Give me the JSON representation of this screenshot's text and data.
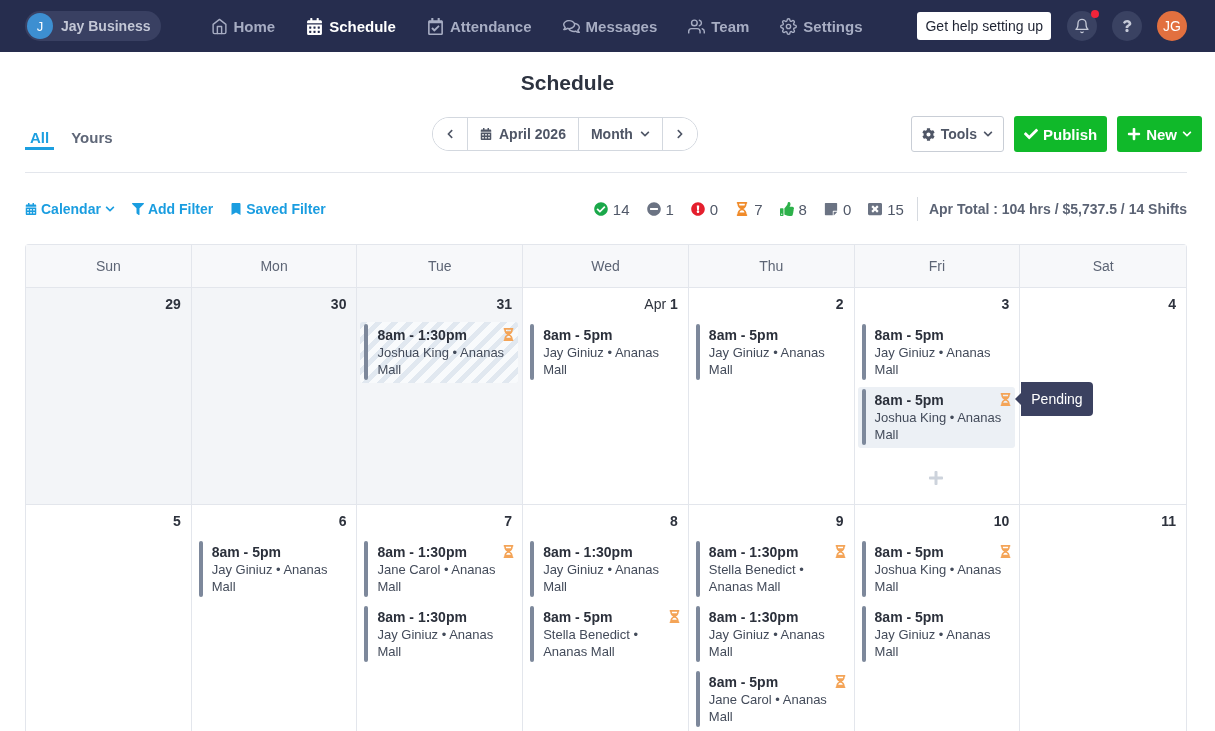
{
  "top_nav": {
    "workspace": {
      "initial": "J",
      "name": "Jay Business"
    },
    "items": [
      {
        "kind": "home",
        "label": "Home",
        "selected": false
      },
      {
        "kind": "schedule",
        "label": "Schedule",
        "selected": true
      },
      {
        "kind": "attendance",
        "label": "Attendance",
        "selected": false
      },
      {
        "kind": "messages",
        "label": "Messages",
        "selected": false
      },
      {
        "kind": "team",
        "label": "Team",
        "selected": false
      },
      {
        "kind": "settings",
        "label": "Settings",
        "selected": false
      }
    ],
    "help_button": "Get help setting up",
    "unread_notifications": true,
    "user_initials": "JG"
  },
  "page_title": "Schedule",
  "view_tabs": [
    {
      "label": "All",
      "selected": true
    },
    {
      "label": "Yours",
      "selected": false
    }
  ],
  "date_nav": {
    "period": "April 2026",
    "view": "Month"
  },
  "actions": [
    {
      "kind": "tools",
      "label": "Tools"
    },
    {
      "kind": "publish",
      "label": "Publish"
    },
    {
      "kind": "new",
      "label": "New"
    }
  ],
  "filters": [
    {
      "kind": "calendar",
      "label": "Calendar",
      "dropdown": true
    },
    {
      "kind": "filter",
      "label": "Add Filter",
      "dropdown": false
    },
    {
      "kind": "bookmark",
      "label": "Saved Filter",
      "dropdown": false
    }
  ],
  "stats": [
    {
      "kind": "check",
      "count": "14"
    },
    {
      "kind": "minus",
      "count": "1"
    },
    {
      "kind": "alert",
      "count": "0"
    },
    {
      "kind": "hourglass",
      "count": "7"
    },
    {
      "kind": "thumbs-up",
      "count": "8"
    },
    {
      "kind": "note",
      "count": "0"
    },
    {
      "kind": "cross",
      "count": "15"
    }
  ],
  "totals": "Apr Total : 104 hrs / $5,737.5 / 14 Shifts",
  "calendar": {
    "weekdays": [
      "Sun",
      "Mon",
      "Tue",
      "Wed",
      "Thu",
      "Fri",
      "Sat"
    ],
    "weeks": [
      {
        "days": [
          {
            "date": "29",
            "outside_month": true,
            "hovered": false
          },
          {
            "date": "30",
            "outside_month": true,
            "hovered": false
          },
          {
            "date": "31",
            "outside_month": true,
            "hovered": false,
            "shifts": [
              {
                "time": "8am - 1:30pm",
                "details": "Joshua King • Ananas Mall",
                "pending": true,
                "striped": true,
                "highlighted": false
              }
            ]
          },
          {
            "month": "Apr",
            "date": "1",
            "outside_month": false,
            "hovered": false,
            "shifts": [
              {
                "time": "8am - 5pm",
                "details": "Jay Giniuz • Ananas Mall",
                "pending": false,
                "striped": false,
                "highlighted": false
              }
            ]
          },
          {
            "date": "2",
            "outside_month": false,
            "hovered": false,
            "shifts": [
              {
                "time": "8am - 5pm",
                "details": "Jay Giniuz • Ananas Mall",
                "pending": false,
                "striped": false,
                "highlighted": false
              }
            ]
          },
          {
            "date": "3",
            "outside_month": false,
            "hovered": true,
            "shifts": [
              {
                "time": "8am - 5pm",
                "details": "Jay Giniuz • Ananas Mall",
                "pending": false,
                "striped": false,
                "highlighted": false
              },
              {
                "time": "8am - 5pm",
                "details": "Joshua King • Ananas Mall",
                "pending": true,
                "striped": false,
                "highlighted": true,
                "tooltip": "Pending"
              }
            ]
          },
          {
            "date": "4",
            "outside_month": false,
            "hovered": false
          }
        ]
      },
      {
        "days": [
          {
            "date": "5",
            "outside_month": false,
            "hovered": false
          },
          {
            "date": "6",
            "outside_month": false,
            "hovered": false,
            "shifts": [
              {
                "time": "8am - 5pm",
                "details": "Jay Giniuz • Ananas Mall",
                "pending": false,
                "striped": false,
                "highlighted": false
              }
            ]
          },
          {
            "date": "7",
            "outside_month": false,
            "hovered": false,
            "shifts": [
              {
                "time": "8am - 1:30pm",
                "details": "Jane Carol • Ananas Mall",
                "pending": true,
                "striped": false,
                "highlighted": false
              },
              {
                "time": "8am - 1:30pm",
                "details": "Jay Giniuz • Ananas Mall",
                "pending": false,
                "striped": false,
                "highlighted": false
              }
            ]
          },
          {
            "date": "8",
            "outside_month": false,
            "hovered": false,
            "shifts": [
              {
                "time": "8am - 1:30pm",
                "details": "Jay Giniuz • Ananas Mall",
                "pending": false,
                "striped": false,
                "highlighted": false
              },
              {
                "time": "8am - 5pm",
                "details": "Stella Benedict • Ananas Mall",
                "pending": true,
                "striped": false,
                "highlighted": false
              }
            ]
          },
          {
            "date": "9",
            "outside_month": false,
            "hovered": false,
            "shifts": [
              {
                "time": "8am - 1:30pm",
                "details": "Stella Benedict • Ananas Mall",
                "pending": true,
                "striped": false,
                "highlighted": false
              },
              {
                "time": "8am - 1:30pm",
                "details": "Jay Giniuz • Ananas Mall",
                "pending": false,
                "striped": false,
                "highlighted": false
              },
              {
                "time": "8am - 5pm",
                "details": "Jane Carol • Ananas Mall",
                "pending": true,
                "striped": false,
                "highlighted": false
              }
            ]
          },
          {
            "date": "10",
            "outside_month": false,
            "hovered": false,
            "shifts": [
              {
                "time": "8am - 5pm",
                "details": "Joshua King • Ananas Mall",
                "pending": true,
                "striped": false,
                "highlighted": false
              },
              {
                "time": "8am - 5pm",
                "details": "Jay Giniuz • Ananas Mall",
                "pending": false,
                "striped": false,
                "highlighted": false
              }
            ]
          },
          {
            "date": "11",
            "outside_month": false,
            "hovered": false
          }
        ]
      }
    ]
  }
}
